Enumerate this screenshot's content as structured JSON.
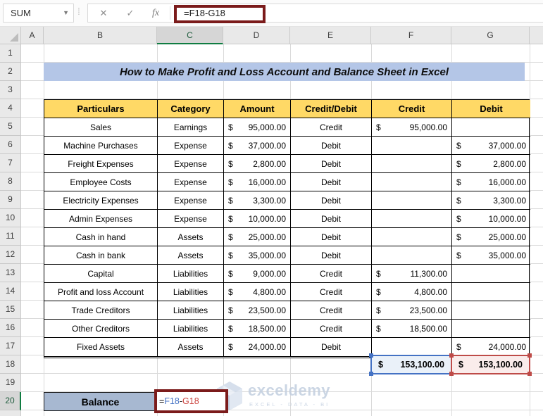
{
  "chrome": {
    "name_box": "SUM",
    "cancel_icon": "✕",
    "enter_icon": "✓",
    "fx_icon": "fx",
    "formula_bar": "=F18-G18"
  },
  "sheet": {
    "columns": [
      "A",
      "B",
      "C",
      "D",
      "E",
      "F",
      "G"
    ],
    "selected_column": "C",
    "rows": [
      "1",
      "2",
      "3",
      "4",
      "5",
      "6",
      "7",
      "8",
      "9",
      "10",
      "11",
      "12",
      "13",
      "14",
      "15",
      "16",
      "17",
      "18",
      "19",
      "20"
    ],
    "selected_row": "20"
  },
  "title_banner": "How to Make Profit and Loss Account and Balance Sheet in Excel",
  "currency": "$",
  "table": {
    "headers": [
      "Particulars",
      "Category",
      "Amount",
      "Credit/Debit",
      "Credit",
      "Debit"
    ],
    "rows": [
      {
        "particulars": "Sales",
        "category": "Earnings",
        "amount": "95,000.00",
        "type": "Credit",
        "credit": "95,000.00",
        "debit": ""
      },
      {
        "particulars": "Machine Purchases",
        "category": "Expense",
        "amount": "37,000.00",
        "type": "Debit",
        "credit": "",
        "debit": "37,000.00"
      },
      {
        "particulars": "Freight Expenses",
        "category": "Expense",
        "amount": "2,800.00",
        "type": "Debit",
        "credit": "",
        "debit": "2,800.00"
      },
      {
        "particulars": "Employee Costs",
        "category": "Expense",
        "amount": "16,000.00",
        "type": "Debit",
        "credit": "",
        "debit": "16,000.00"
      },
      {
        "particulars": "Electricity Expenses",
        "category": "Expense",
        "amount": "3,300.00",
        "type": "Debit",
        "credit": "",
        "debit": "3,300.00"
      },
      {
        "particulars": "Admin Expenses",
        "category": "Expense",
        "amount": "10,000.00",
        "type": "Debit",
        "credit": "",
        "debit": "10,000.00"
      },
      {
        "particulars": "Cash in hand",
        "category": "Assets",
        "amount": "25,000.00",
        "type": "Debit",
        "credit": "",
        "debit": "25,000.00"
      },
      {
        "particulars": "Cash in bank",
        "category": "Assets",
        "amount": "35,000.00",
        "type": "Debit",
        "credit": "",
        "debit": "35,000.00"
      },
      {
        "particulars": "Capital",
        "category": "Liabilities",
        "amount": "9,000.00",
        "type": "Credit",
        "credit": "11,300.00",
        "debit": ""
      },
      {
        "particulars": "Profit and loss Account",
        "category": "Liabilities",
        "amount": "4,800.00",
        "type": "Credit",
        "credit": "4,800.00",
        "debit": ""
      },
      {
        "particulars": "Trade Creditors",
        "category": "Liabilities",
        "amount": "23,500.00",
        "type": "Credit",
        "credit": "23,500.00",
        "debit": ""
      },
      {
        "particulars": "Other Creditors",
        "category": "Liabilities",
        "amount": "18,500.00",
        "type": "Credit",
        "credit": "18,500.00",
        "debit": ""
      },
      {
        "particulars": "Fixed Assets",
        "category": "Assets",
        "amount": "24,000.00",
        "type": "Debit",
        "credit": "",
        "debit": "24,000.00"
      }
    ],
    "totals": {
      "credit": "153,100.00",
      "debit": "153,100.00"
    }
  },
  "balance": {
    "label": "Balance",
    "formula": {
      "eq": "=",
      "ref1": "F18",
      "op": "-",
      "ref2": "G18"
    }
  },
  "watermark": {
    "name": "exceldemy",
    "tagline": "EXCEL - DATA - BI"
  },
  "colors": {
    "header_fill": "#FFD966",
    "banner_fill": "#B4C6E7",
    "balance_fill": "#A7B8D1",
    "credit_accent": "#4472C4",
    "credit_fill": "#EAF1F9",
    "debit_accent": "#BE4B48",
    "debit_fill": "#FAECEB",
    "annotation": "#7B1B1B",
    "selection_green": "#107C41",
    "watermark": "#C3CFE0"
  }
}
